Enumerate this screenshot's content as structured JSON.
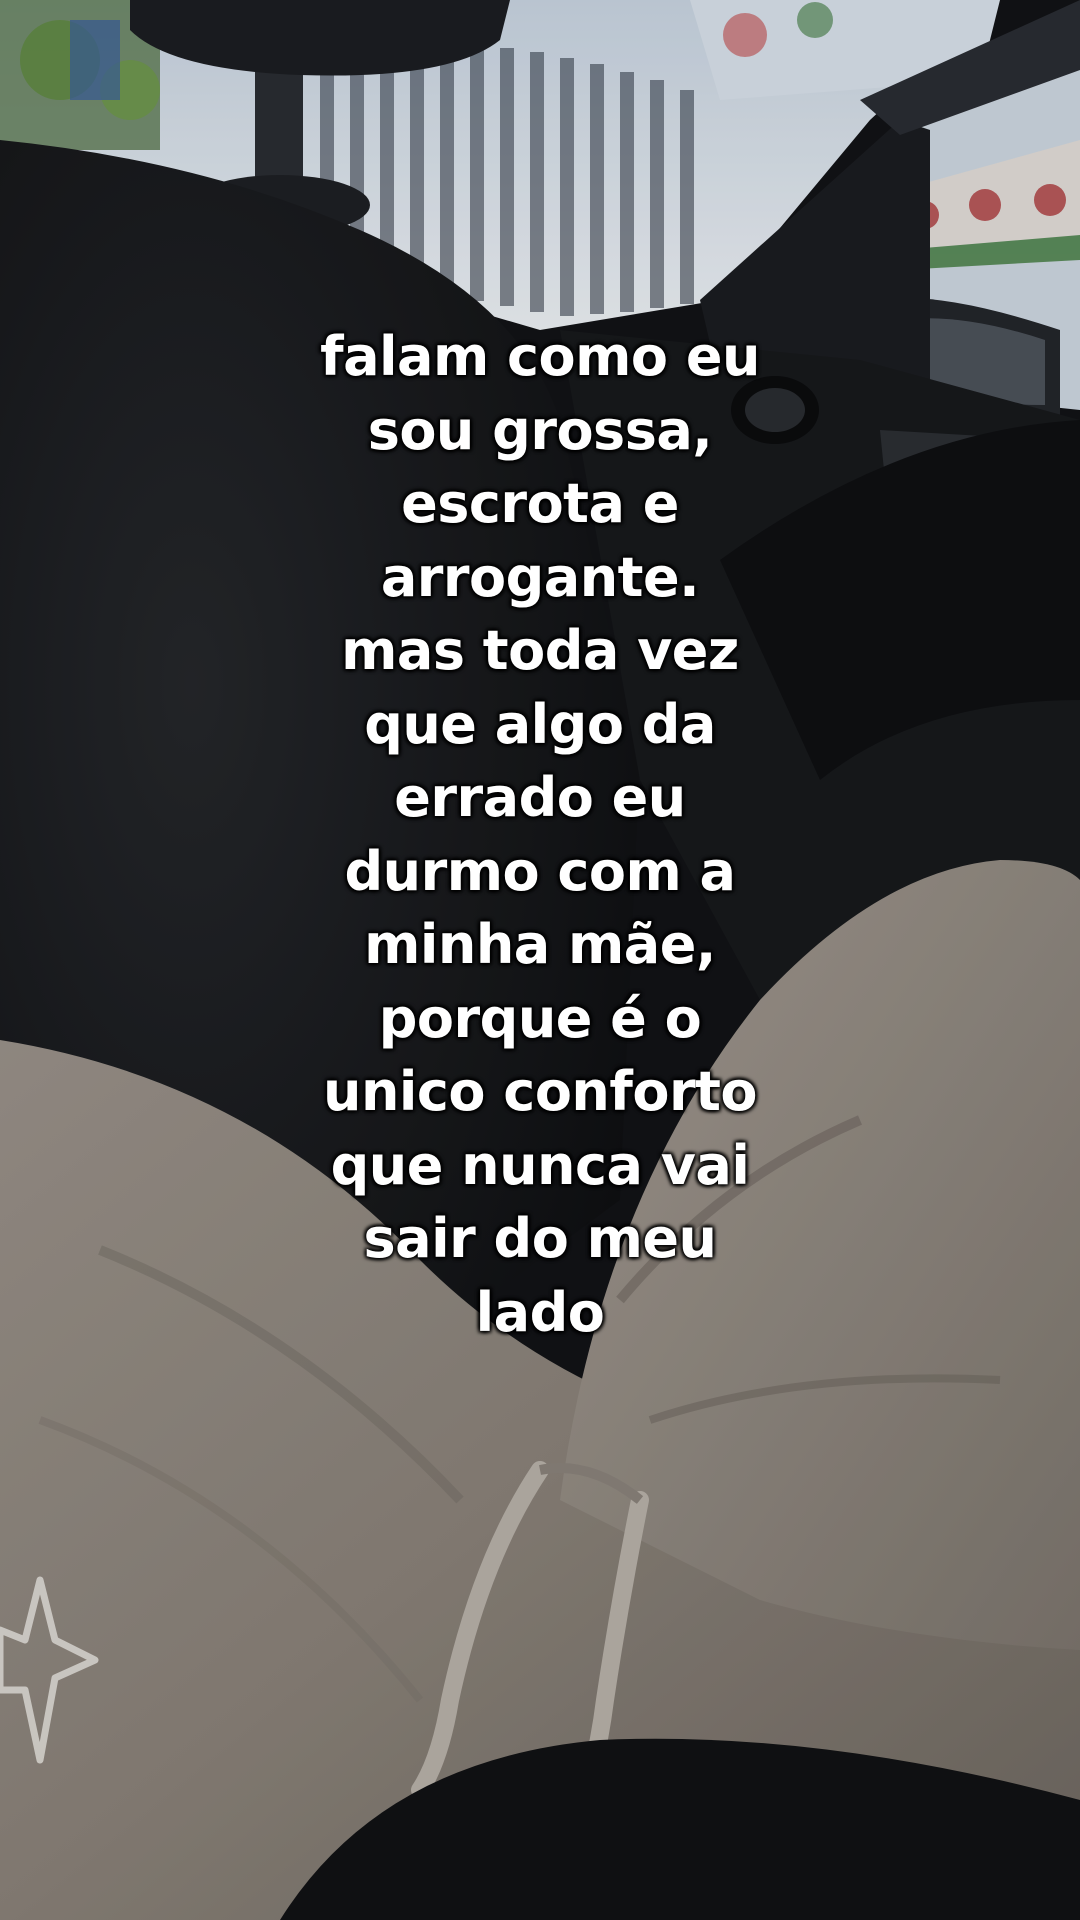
{
  "caption": {
    "lines": [
      "falam como eu",
      "sou grossa,",
      "escrota e",
      "arrogante.",
      "mas toda vez",
      "que algo da",
      "errado eu",
      "durmo com a",
      "minha mãe,",
      "porque é o",
      "unico conforto",
      "que nunca vai",
      "sair do meu",
      "lado"
    ]
  },
  "colors": {
    "car_interior_dark": "#141518",
    "window_light": "#dfe6ee",
    "hoodie_gray": "#8f877f",
    "text": "#ffffff"
  },
  "icons": [
    "star-logo-icon"
  ]
}
